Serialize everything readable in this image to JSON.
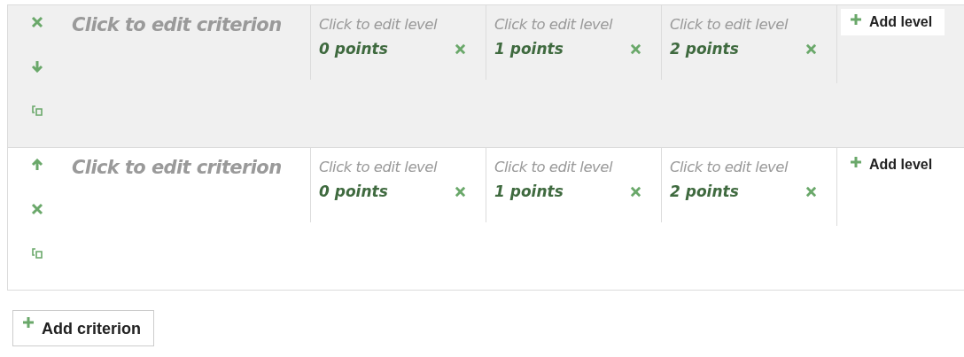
{
  "criteria": [
    {
      "highlighted": true,
      "actions": [
        {
          "kind": "delete"
        },
        {
          "kind": "move-down"
        },
        {
          "kind": "duplicate"
        }
      ],
      "description": "Click to edit criterion",
      "levels": [
        {
          "definition": "Click to edit level",
          "score": "0 points"
        },
        {
          "definition": "Click to edit level",
          "score": "1 points"
        },
        {
          "definition": "Click to edit level",
          "score": "2 points"
        }
      ],
      "add_level": "Add level"
    },
    {
      "highlighted": false,
      "actions": [
        {
          "kind": "move-up"
        },
        {
          "kind": "delete"
        },
        {
          "kind": "duplicate"
        }
      ],
      "description": "Click to edit criterion",
      "levels": [
        {
          "definition": "Click to edit level",
          "score": "0 points"
        },
        {
          "definition": "Click to edit level",
          "score": "1 points"
        },
        {
          "definition": "Click to edit level",
          "score": "2 points"
        }
      ],
      "add_level": "Add level"
    }
  ],
  "add_criterion": "Add criterion"
}
